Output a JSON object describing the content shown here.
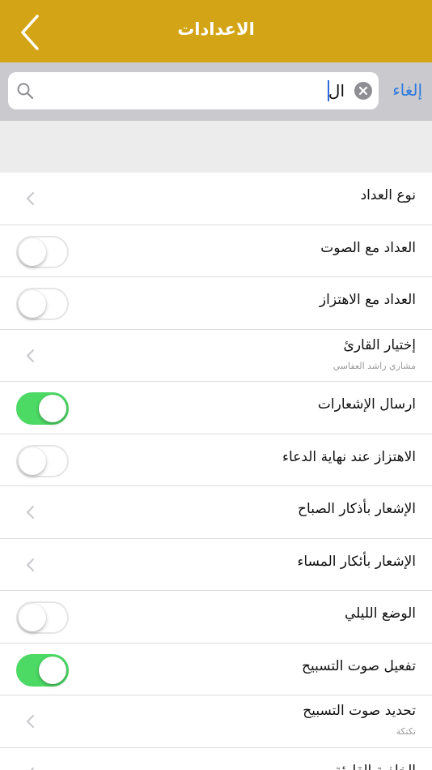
{
  "nav": {
    "title": "الاعدادات",
    "back_icon": "chevron-left-icon"
  },
  "search": {
    "value": "ال",
    "cancel_label": "إلغاء",
    "search_icon": "search-icon",
    "clear_icon": "clear-icon"
  },
  "colors": {
    "nav_background": "#d3a416",
    "toggle_on": "#4cd964",
    "cancel_text": "#2d7ae0"
  },
  "settings": [
    {
      "title": "نوع العداد",
      "control": "chevron"
    },
    {
      "title": "العداد مع الصوت",
      "control": "toggle",
      "on": false
    },
    {
      "title": "العداد مع الاهتزاز",
      "control": "toggle",
      "on": false
    },
    {
      "title": "إختيار القارئ",
      "subtitle": "مشاري راشد العفاسي",
      "control": "chevron"
    },
    {
      "title": "ارسال الإشعارات",
      "control": "toggle",
      "on": true
    },
    {
      "title": "الاهتزاز عند نهاية الدعاء",
      "control": "toggle",
      "on": false
    },
    {
      "title": "الإشعار بأذكار الصباح",
      "control": "chevron"
    },
    {
      "title": "الإشعار بأئكار المساء",
      "control": "chevron"
    },
    {
      "title": "الوضع الليلي",
      "control": "toggle",
      "on": false
    },
    {
      "title": "تفعيل صوت التسبيح",
      "control": "toggle",
      "on": true
    },
    {
      "title": "تحديد صوت التسبيح",
      "subtitle": "تكتكة",
      "control": "chevron"
    },
    {
      "title": "الخلفية القارئة",
      "control": "chevron"
    }
  ]
}
